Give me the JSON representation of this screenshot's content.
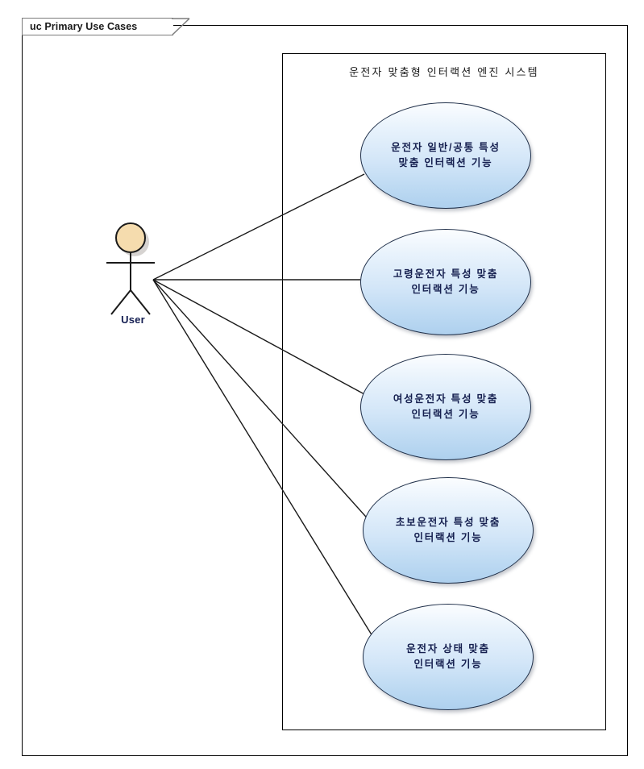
{
  "diagram": {
    "frame_title": "uc Primary Use Cases",
    "type": "uml-use-case-diagram",
    "system_boundary_title": "운전자 맞춤형 인터랙션 엔진 시스템",
    "actor": {
      "name": "User",
      "icon": "stick-figure-actor-icon",
      "head_color": "#f5dcae",
      "outline_color": "#1a1a1a"
    },
    "use_cases": [
      {
        "id": "uc1",
        "label": "운전자 일반/공통 특성\n맞춤 인터랙션 기능"
      },
      {
        "id": "uc2",
        "label": "고령운전자 특성 맞춤\n인터랙션 기능"
      },
      {
        "id": "uc3",
        "label": "여성운전자 특성 맞춤\n인터랙션 기능"
      },
      {
        "id": "uc4",
        "label": "초보운전자 특성 맞춤\n인터랙션 기능"
      },
      {
        "id": "uc5",
        "label": "운전자 상태 맞춤\n인터랙션 기능"
      }
    ],
    "associations": [
      {
        "from": "User",
        "to": "uc1"
      },
      {
        "from": "User",
        "to": "uc2"
      },
      {
        "from": "User",
        "to": "uc3"
      },
      {
        "from": "User",
        "to": "uc4"
      },
      {
        "from": "User",
        "to": "uc5"
      }
    ],
    "colors": {
      "usecase_fill_top": "#fbfdff",
      "usecase_fill_bottom": "#aed0ee",
      "usecase_stroke": "#20304a",
      "usecase_text": "#151f4f",
      "line": "#1a1a1a",
      "frame_stroke": "#000000",
      "tab_stroke": "#7b7b7b",
      "background": "#ffffff"
    }
  }
}
